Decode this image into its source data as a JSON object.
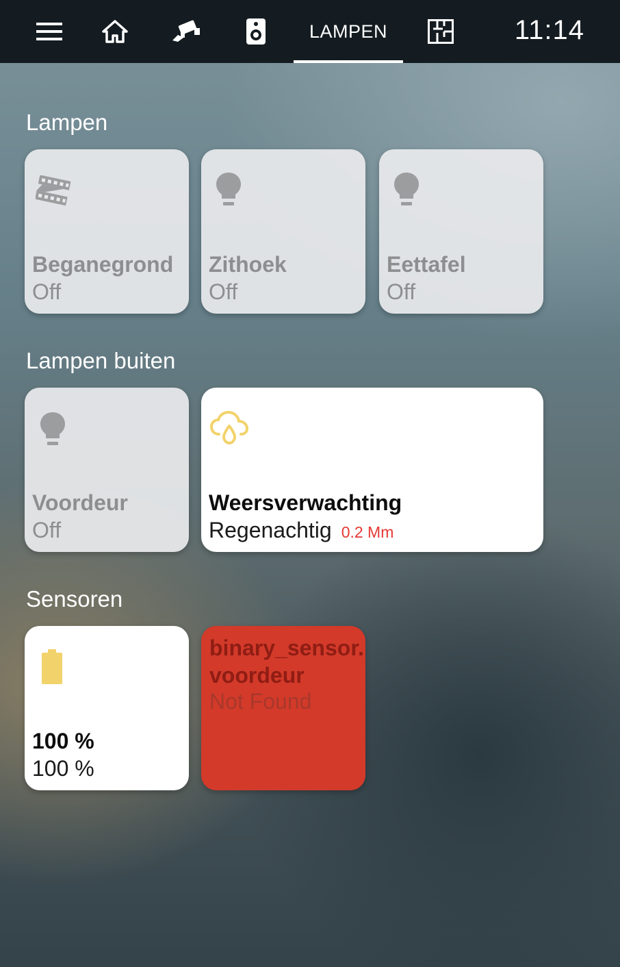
{
  "topbar": {
    "tabs": [
      {
        "icon": "menu-icon"
      },
      {
        "icon": "home-icon"
      },
      {
        "icon": "cctv-camera-icon"
      },
      {
        "icon": "speaker-icon"
      },
      {
        "label": "LAMPEN",
        "active": true
      },
      {
        "icon": "floorplan-icon"
      }
    ],
    "clock": "11:14"
  },
  "groups": [
    {
      "title": "Lampen",
      "cards": [
        {
          "name": "Beganegrond",
          "state": "Off",
          "icon": "film-strip-icon"
        },
        {
          "name": "Zithoek",
          "state": "Off",
          "icon": "lightbulb-icon"
        },
        {
          "name": "Eettafel",
          "state": "Off",
          "icon": "lightbulb-icon"
        }
      ]
    },
    {
      "title": "Lampen buiten",
      "cards": [
        {
          "name": "Voordeur",
          "state": "Off",
          "icon": "lightbulb-icon"
        },
        {
          "name": "Weersverwachting",
          "state": "Regenachtig",
          "sub_value": "0.2 Mm",
          "icon": "rain-cloud-icon"
        }
      ]
    },
    {
      "title": "Sensoren",
      "cards": [
        {
          "name": "100 %",
          "state": "100 %",
          "icon": "battery-icon"
        },
        {
          "name_line1": "binary_sensor.",
          "name_line2": "voordeur",
          "state": "Not Found"
        }
      ]
    }
  ],
  "colors": {
    "topbar": "#141c21",
    "icon_off": "#9b9d9f",
    "icon_on": "#f2d36b",
    "error_card": "#d33a2a",
    "sub_value": "#e53935"
  }
}
